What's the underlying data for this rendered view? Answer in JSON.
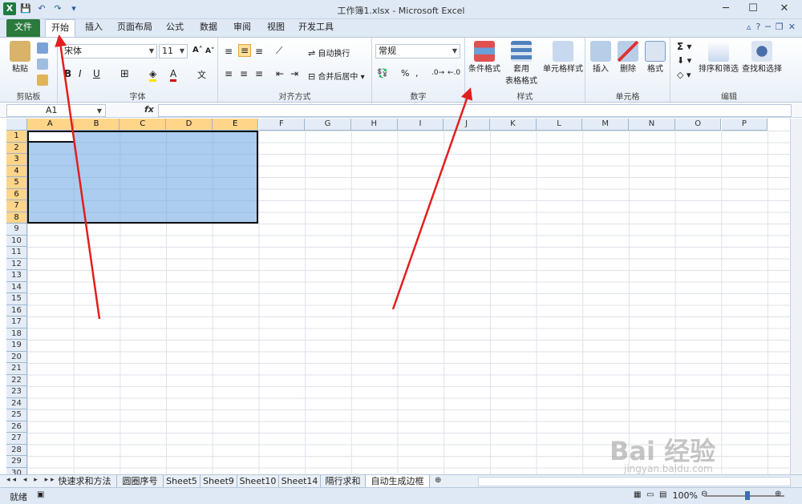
{
  "window": {
    "title": "工作簿1.xlsx - Microsoft Excel",
    "controls": [
      "─",
      "☐",
      "✕"
    ]
  },
  "qat": [
    "X",
    "💾",
    "↶",
    "↷",
    "▾"
  ],
  "tabs": [
    "文件",
    "开始",
    "插入",
    "页面布局",
    "公式",
    "数据",
    "审阅",
    "视图",
    "开发工具"
  ],
  "ribbon": {
    "clipboard": {
      "paste": "粘贴",
      "label": "剪贴板"
    },
    "font": {
      "name": "宋体",
      "size": "11",
      "label": "字体"
    },
    "alignment": {
      "wrap": "自动换行",
      "merge": "合并后居中",
      "label": "对齐方式"
    },
    "number": {
      "format": "常规",
      "label": "数字"
    },
    "styles": {
      "conditional": "条件格式",
      "table1": "套用",
      "table2": "表格格式",
      "cell_styles": "单元格样式",
      "label": "样式"
    },
    "cells": {
      "insert": "插入",
      "delete": "删除",
      "format": "格式",
      "label": "单元格"
    },
    "editing": {
      "sort": "排序和筛选",
      "find": "查找和选择",
      "label": "编辑"
    }
  },
  "formula": {
    "namebox": "A1",
    "fx": "fx"
  },
  "columns": [
    "A",
    "B",
    "C",
    "D",
    "E",
    "F",
    "G",
    "H",
    "I",
    "J",
    "K",
    "L",
    "M",
    "N",
    "O",
    "P"
  ],
  "rows": [
    "1",
    "2",
    "3",
    "4",
    "5",
    "6",
    "7",
    "8",
    "9",
    "10",
    "11",
    "12",
    "13",
    "14",
    "15",
    "16",
    "17",
    "18",
    "19",
    "20",
    "21",
    "22",
    "23",
    "24",
    "25",
    "26",
    "27",
    "28",
    "29",
    "30"
  ],
  "sheets": [
    "快速求和方法",
    "圆圈序号",
    "Sheet5",
    "Sheet9",
    "Sheet10",
    "Sheet14",
    "隔行求和",
    "自动生成边框"
  ],
  "status": {
    "ready": "就绪",
    "zoom": "100%"
  },
  "watermark": {
    "brand": "Bai 经验",
    "url": "jingyan.baidu.com"
  }
}
